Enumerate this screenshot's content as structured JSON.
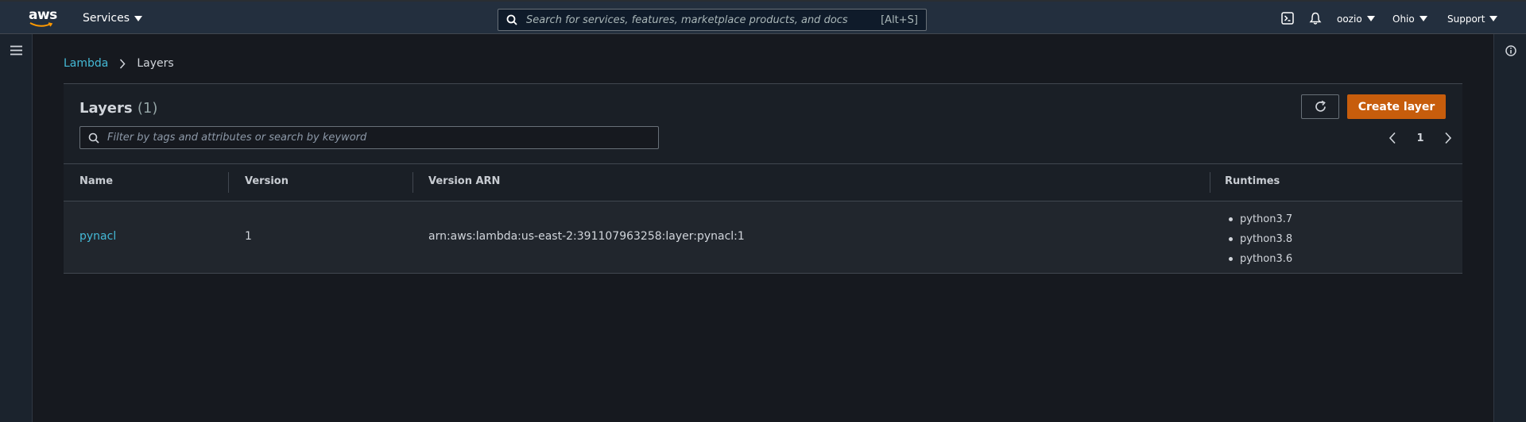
{
  "topnav": {
    "logo_text": "aws",
    "services_label": "Services",
    "search_placeholder": "Search for services, features, marketplace products, and docs",
    "search_shortcut": "[Alt+S]",
    "user_label": "oozio",
    "region_label": "Ohio",
    "support_label": "Support"
  },
  "breadcrumb": {
    "parent": "Lambda",
    "current": "Layers"
  },
  "panel": {
    "title": "Layers",
    "count": "(1)",
    "create_button": "Create layer",
    "filter_placeholder": "Filter by tags and attributes or search by keyword",
    "page_number": "1"
  },
  "table": {
    "columns": [
      "Name",
      "Version",
      "Version ARN",
      "Runtimes"
    ],
    "rows": [
      {
        "name": "pynacl",
        "version": "1",
        "arn": "arn:aws:lambda:us-east-2:391107963258:layer:pynacl:1",
        "runtimes": [
          "python3.7",
          "python3.8",
          "python3.6"
        ]
      }
    ]
  },
  "colors": {
    "accent_link": "#44b9d6",
    "primary_button": "#c75d0c",
    "nav_bg": "#232f3e"
  }
}
